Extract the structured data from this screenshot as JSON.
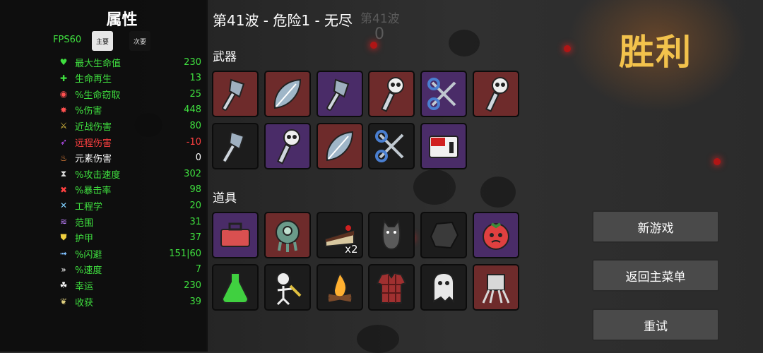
{
  "stats_panel": {
    "title": "属性",
    "fps": "FPS60",
    "tab_primary": "主要",
    "tab_secondary": "次要",
    "stats": [
      {
        "icon": "heart-icon",
        "label": "最大生命值",
        "value": "230",
        "tone": "positive"
      },
      {
        "icon": "regen-icon",
        "label": "生命再生",
        "value": "13",
        "tone": "positive"
      },
      {
        "icon": "lifesteal-icon",
        "label": "%生命窃取",
        "value": "25",
        "tone": "positive"
      },
      {
        "icon": "damage-icon",
        "label": "%伤害",
        "value": "448",
        "tone": "positive"
      },
      {
        "icon": "melee-icon",
        "label": "近战伤害",
        "value": "80",
        "tone": "positive"
      },
      {
        "icon": "ranged-icon",
        "label": "远程伤害",
        "value": "-10",
        "tone": "negative"
      },
      {
        "icon": "elemental-icon",
        "label": "元素伤害",
        "value": "0",
        "tone": "neutral"
      },
      {
        "icon": "attack-speed-icon",
        "label": "%攻击速度",
        "value": "302",
        "tone": "positive"
      },
      {
        "icon": "crit-icon",
        "label": "%暴击率",
        "value": "98",
        "tone": "positive"
      },
      {
        "icon": "engineering-icon",
        "label": "工程学",
        "value": "20",
        "tone": "positive"
      },
      {
        "icon": "range-icon",
        "label": "范围",
        "value": "31",
        "tone": "positive"
      },
      {
        "icon": "armor-icon",
        "label": "护甲",
        "value": "37",
        "tone": "positive"
      },
      {
        "icon": "dodge-icon",
        "label": "%闪避",
        "value": "151|60",
        "tone": "positive"
      },
      {
        "icon": "speed-icon",
        "label": "%速度",
        "value": "7",
        "tone": "positive"
      },
      {
        "icon": "luck-icon",
        "label": "幸运",
        "value": "230",
        "tone": "positive"
      },
      {
        "icon": "harvest-icon",
        "label": "收获",
        "value": "39",
        "tone": "positive"
      }
    ]
  },
  "header": {
    "wave_title": "第41波 - 危险1 - 无尽",
    "bg_wave_text": "第41波",
    "bg_count": "0"
  },
  "weapons": {
    "label": "武器",
    "items": [
      {
        "icon": "axe-icon",
        "tier": "red"
      },
      {
        "icon": "leaf-blade-icon",
        "tier": "red"
      },
      {
        "icon": "axe-icon",
        "tier": "purple"
      },
      {
        "icon": "skull-staff-icon",
        "tier": "red"
      },
      {
        "icon": "scissors-icon",
        "tier": "purple"
      },
      {
        "icon": "skull-staff-icon",
        "tier": "red"
      },
      {
        "icon": "axe-icon",
        "tier": "black"
      },
      {
        "icon": "skull-staff-icon",
        "tier": "purple"
      },
      {
        "icon": "leaf-blade-icon",
        "tier": "red"
      },
      {
        "icon": "scissors-icon",
        "tier": "black"
      },
      {
        "icon": "stapler-icon",
        "tier": "purple"
      }
    ]
  },
  "items": {
    "label": "道具",
    "items": [
      {
        "icon": "toolbox-icon",
        "tier": "purple",
        "qty": ""
      },
      {
        "icon": "alien-pod-icon",
        "tier": "red",
        "qty": ""
      },
      {
        "icon": "cake-icon",
        "tier": "black",
        "qty": "x2"
      },
      {
        "icon": "cat-icon",
        "tier": "black",
        "qty": ""
      },
      {
        "icon": "rock-icon",
        "tier": "black",
        "qty": ""
      },
      {
        "icon": "tomato-icon",
        "tier": "purple",
        "qty": ""
      },
      {
        "icon": "potion-icon",
        "tier": "black",
        "qty": ""
      },
      {
        "icon": "skeleton-icon",
        "tier": "black",
        "qty": ""
      },
      {
        "icon": "campfire-icon",
        "tier": "black",
        "qty": ""
      },
      {
        "icon": "flannel-shirt-icon",
        "tier": "black",
        "qty": ""
      },
      {
        "icon": "ghost-icon",
        "tier": "black",
        "qty": ""
      },
      {
        "icon": "robot-legs-icon",
        "tier": "red",
        "qty": ""
      }
    ]
  },
  "result": {
    "title": "胜利",
    "new_game": "新游戏",
    "main_menu": "返回主菜单",
    "retry": "重试"
  },
  "colors": {
    "positive": "#3fe03f",
    "negative": "#ff4040",
    "victory": "#f2c24c",
    "tier_red": "#6e2b2b",
    "tier_purple": "#4a2c68",
    "tier_black": "#1c1c1c"
  }
}
